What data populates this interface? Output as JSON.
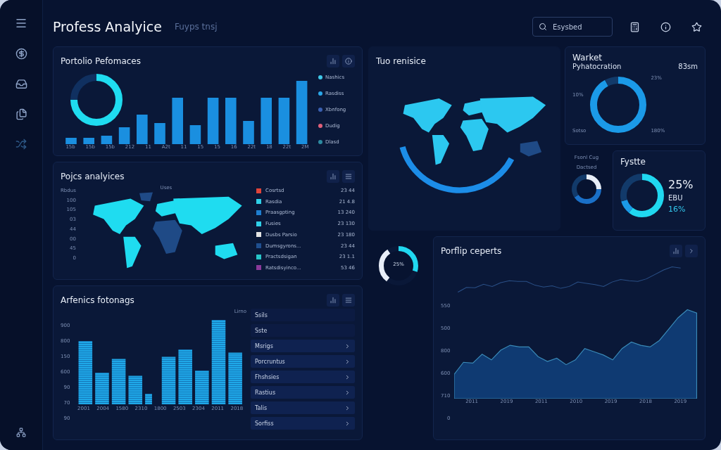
{
  "app": {
    "title": "Profess Analyice",
    "subtitle": "Fuyps tnsj"
  },
  "search": {
    "placeholder": "Esysbed"
  },
  "portfolio_performance": {
    "title": "Portolio Pefomaces",
    "x_labels": [
      "15b",
      "15b",
      "15b",
      "212",
      "11",
      "A2t",
      "11",
      "15",
      "15",
      "16",
      "22t",
      "18",
      "22t",
      "2M"
    ],
    "legend": [
      {
        "label": "Nashics",
        "color": "#3fc8e8"
      },
      {
        "label": "Rasdiss",
        "color": "#2aa6e8"
      },
      {
        "label": "Xbnfong",
        "color": "#3a5fb0"
      },
      {
        "label": "Dudig",
        "color": "#e0607a"
      },
      {
        "label": "Dlasd",
        "color": "#2d8aa0"
      }
    ]
  },
  "map_panel": {
    "title": "Pojcs analyices",
    "axis_title": "Uses",
    "side_label": "Rbdus",
    "y_labels": [
      "100",
      "105",
      "03",
      "44",
      "00",
      "45",
      "0"
    ],
    "legend": [
      {
        "label": "Cosrtsd",
        "value": "23 44",
        "color": "#e0443a"
      },
      {
        "label": "Rasdia",
        "value": "21 4.8",
        "color": "#2fd0e8"
      },
      {
        "label": "Praasgpting",
        "value": "13 240",
        "color": "#1e7ed0"
      },
      {
        "label": "Fusies",
        "value": "23 130",
        "color": "#2fd0e8"
      },
      {
        "label": "Dusbs Parsio",
        "value": "23 180",
        "color": "#e4e4e4"
      },
      {
        "label": "Dumsgyrons...",
        "value": "23 44",
        "color": "#1f4f90"
      },
      {
        "label": "Practsdsigan",
        "value": "23 1.1",
        "color": "#27c4c8"
      },
      {
        "label": "Ratsdisyinco...",
        "value": "53 46",
        "color": "#8a3a9a"
      }
    ]
  },
  "attendance": {
    "title": "Arfenics fotonags",
    "unit": "Lirno",
    "y_labels": [
      "900",
      "800",
      "150",
      "600",
      "90",
      "70",
      "90"
    ],
    "x_labels": [
      "2001",
      "2004",
      "1580",
      "2310",
      "1800",
      "2503",
      "2304",
      "2011",
      "2018"
    ],
    "list": [
      {
        "label": "Ssils",
        "kind": "plain"
      },
      {
        "label": "Sste",
        "kind": "plain"
      },
      {
        "label": "Msrigs",
        "kind": "link"
      },
      {
        "label": "Porcruntus",
        "kind": "link"
      },
      {
        "label": "Fhshsies",
        "kind": "link"
      },
      {
        "label": "Rastius",
        "kind": "link"
      },
      {
        "label": "Talis",
        "kind": "link"
      },
      {
        "label": "Sorfiss",
        "kind": "link"
      }
    ]
  },
  "globe": {
    "title": "Tuo renisice"
  },
  "market": {
    "title": "Warket",
    "subtitle": "Pyhatocration",
    "value": "83sm",
    "labels": [
      "23%",
      "10%",
      "Sotso",
      "180%"
    ]
  },
  "mini_donut": {
    "title": "Fsonl Cug",
    "label": "Dactsed"
  },
  "distribution": {
    "title": "Fystte",
    "value": "25%",
    "label": "EBU",
    "secondary": "16%"
  },
  "gauge": {
    "value": "25%"
  },
  "reports": {
    "title": "Porflip ceperts",
    "y_labels": [
      "550",
      "500",
      "800",
      "600",
      "710",
      "0"
    ],
    "x_labels": [
      "2011",
      "2019",
      "2011",
      "2010",
      "2019",
      "2018",
      "2019"
    ]
  }
}
